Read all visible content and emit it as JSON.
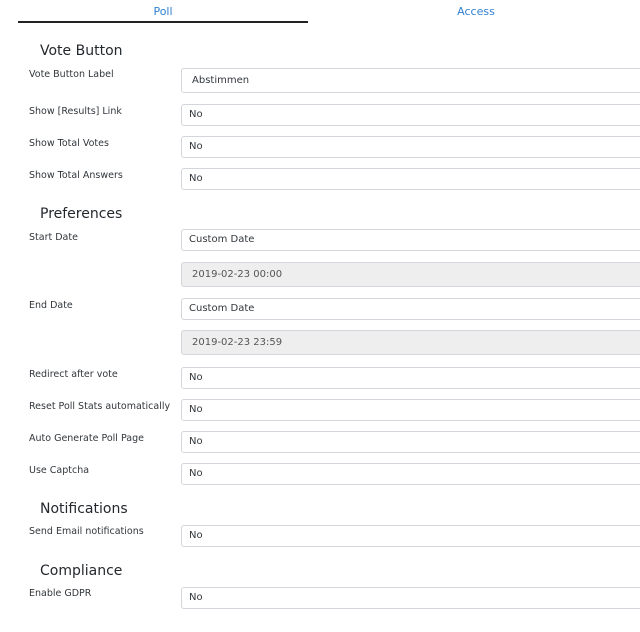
{
  "tabs": [
    {
      "label": "Poll"
    },
    {
      "label": "Access"
    }
  ],
  "sections": {
    "vote_button": {
      "title": "Vote Button",
      "vote_button_label": {
        "label": "Vote Button Label",
        "value": "Abstimmen"
      },
      "show_results_link": {
        "label": "Show [Results] Link",
        "value": "No"
      },
      "show_total_votes": {
        "label": "Show Total Votes",
        "value": "No"
      },
      "show_total_answers": {
        "label": "Show Total Answers",
        "value": "No"
      }
    },
    "preferences": {
      "title": "Preferences",
      "start_date": {
        "label": "Start Date",
        "value": "Custom Date",
        "date": "2019-02-23 00:00"
      },
      "end_date": {
        "label": "End Date",
        "value": "Custom Date",
        "date": "2019-02-23 23:59"
      },
      "redirect_after_vote": {
        "label": "Redirect after vote",
        "value": "No"
      },
      "reset_poll_stats": {
        "label": "Reset Poll Stats automatically",
        "value": "No"
      },
      "auto_generate_page": {
        "label": "Auto Generate Poll Page",
        "value": "No"
      },
      "use_captcha": {
        "label": "Use Captcha",
        "value": "No"
      }
    },
    "notifications": {
      "title": "Notifications",
      "send_email": {
        "label": "Send Email notifications",
        "value": "No"
      }
    },
    "compliance": {
      "title": "Compliance",
      "enable_gdpr": {
        "label": "Enable GDPR",
        "value": "No"
      }
    }
  }
}
